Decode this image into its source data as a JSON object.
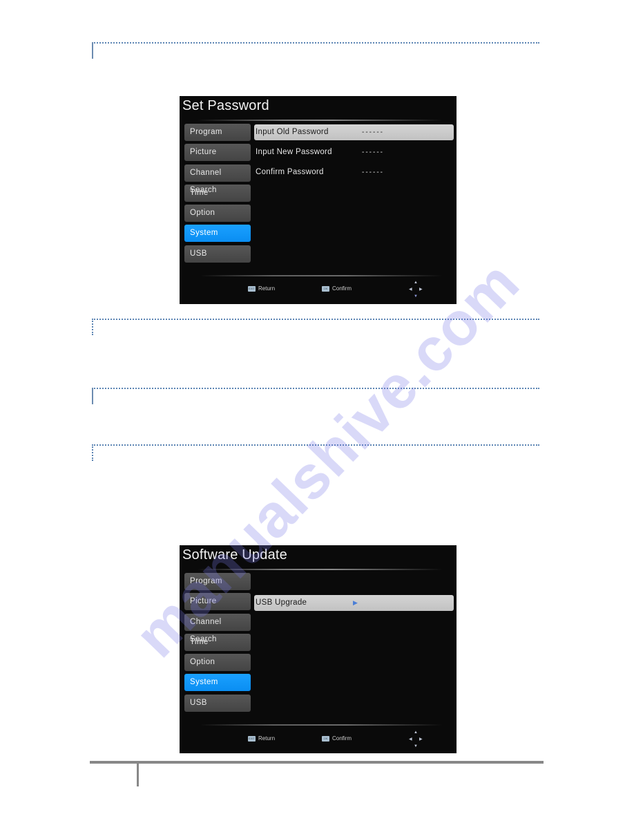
{
  "page": {
    "watermark": "manualshive.com"
  },
  "screens": [
    {
      "title": "Set Password",
      "menu": [
        {
          "label": "Program",
          "active": false
        },
        {
          "label": "Picture",
          "active": false
        },
        {
          "label": "Channel Search",
          "active": false
        },
        {
          "label": "Time",
          "active": false
        },
        {
          "label": "Option",
          "active": false
        },
        {
          "label": "System",
          "active": true
        },
        {
          "label": "USB",
          "active": false
        }
      ],
      "rows": [
        {
          "label": "Input Old Password",
          "value": "------",
          "selected": true
        },
        {
          "label": "Input New Password",
          "value": "------",
          "selected": false
        },
        {
          "label": "Confirm Password",
          "value": "------",
          "selected": false
        }
      ],
      "footer": {
        "return_key": "EXIT",
        "return_label": "Return",
        "confirm_key": "OK",
        "confirm_label": "Confirm",
        "nav_icon": "dpad-icon"
      }
    },
    {
      "title": "Software Update",
      "menu": [
        {
          "label": "Program",
          "active": false
        },
        {
          "label": "Picture",
          "active": false
        },
        {
          "label": "Channel Search",
          "active": false
        },
        {
          "label": "Time",
          "active": false
        },
        {
          "label": "Option",
          "active": false
        },
        {
          "label": "System",
          "active": true
        },
        {
          "label": "USB",
          "active": false
        }
      ],
      "rows": [
        {
          "label": "USB Upgrade",
          "arrow": "▶",
          "selected": true
        }
      ],
      "footer": {
        "return_key": "EXIT",
        "return_label": "Return",
        "confirm_key": "OK",
        "confirm_label": "Confirm",
        "nav_icon": "dpad-icon"
      }
    }
  ],
  "colors": {
    "section_rule": "#5b84b3",
    "active_menu": "#0a8ef2",
    "selected_row": "#c8c8c8",
    "osd_background": "#0a0a0a"
  }
}
